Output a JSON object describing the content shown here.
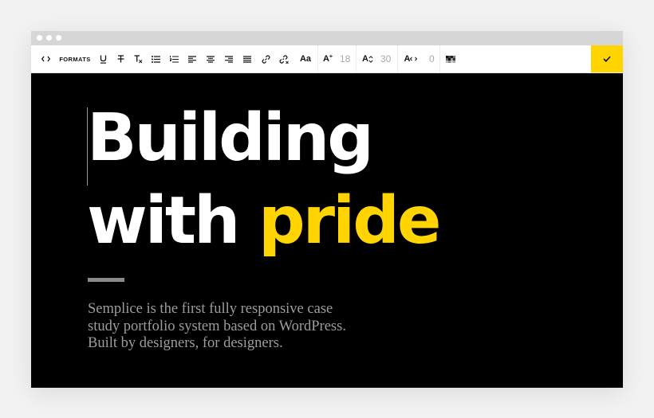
{
  "window": {
    "titlebar_dots": 3
  },
  "toolbar": {
    "code_icon": "code-icon",
    "formats_label": "FORMATS",
    "underline_icon": "underline-icon",
    "strikethrough_icon": "strikethrough-icon",
    "clear_format_icon": "clear-format-icon",
    "bullet_list_icon": "bullet-list-icon",
    "numbered_list_icon": "numbered-list-icon",
    "align_left_icon": "align-left-icon",
    "align_center_icon": "align-center-icon",
    "align_right_icon": "align-right-icon",
    "align_justify_icon": "align-justify-icon",
    "link_icon": "link-icon",
    "unlink_icon": "unlink-icon",
    "font_label": "Aa",
    "font_size_label": "A",
    "font_size_value": "18",
    "line_height_label": "A",
    "line_height_value": "30",
    "letter_spacing_label": "A",
    "letter_spacing_value": "0",
    "color_icon": "color-swatch-icon",
    "confirm_icon": "checkmark-icon"
  },
  "colors": {
    "accent": "#ffd400",
    "background": "#000000",
    "headline": "#ffffff",
    "body_text": "#9d9d9d"
  },
  "content": {
    "headline_line1": "Building",
    "headline_line2_part1": "with ",
    "headline_line2_accent": "pride",
    "paragraph_line1": "Semplice is the first fully responsive case",
    "paragraph_line2": "study portfolio system based on WordPress.",
    "paragraph_line3": "Built by designers, for designers."
  }
}
